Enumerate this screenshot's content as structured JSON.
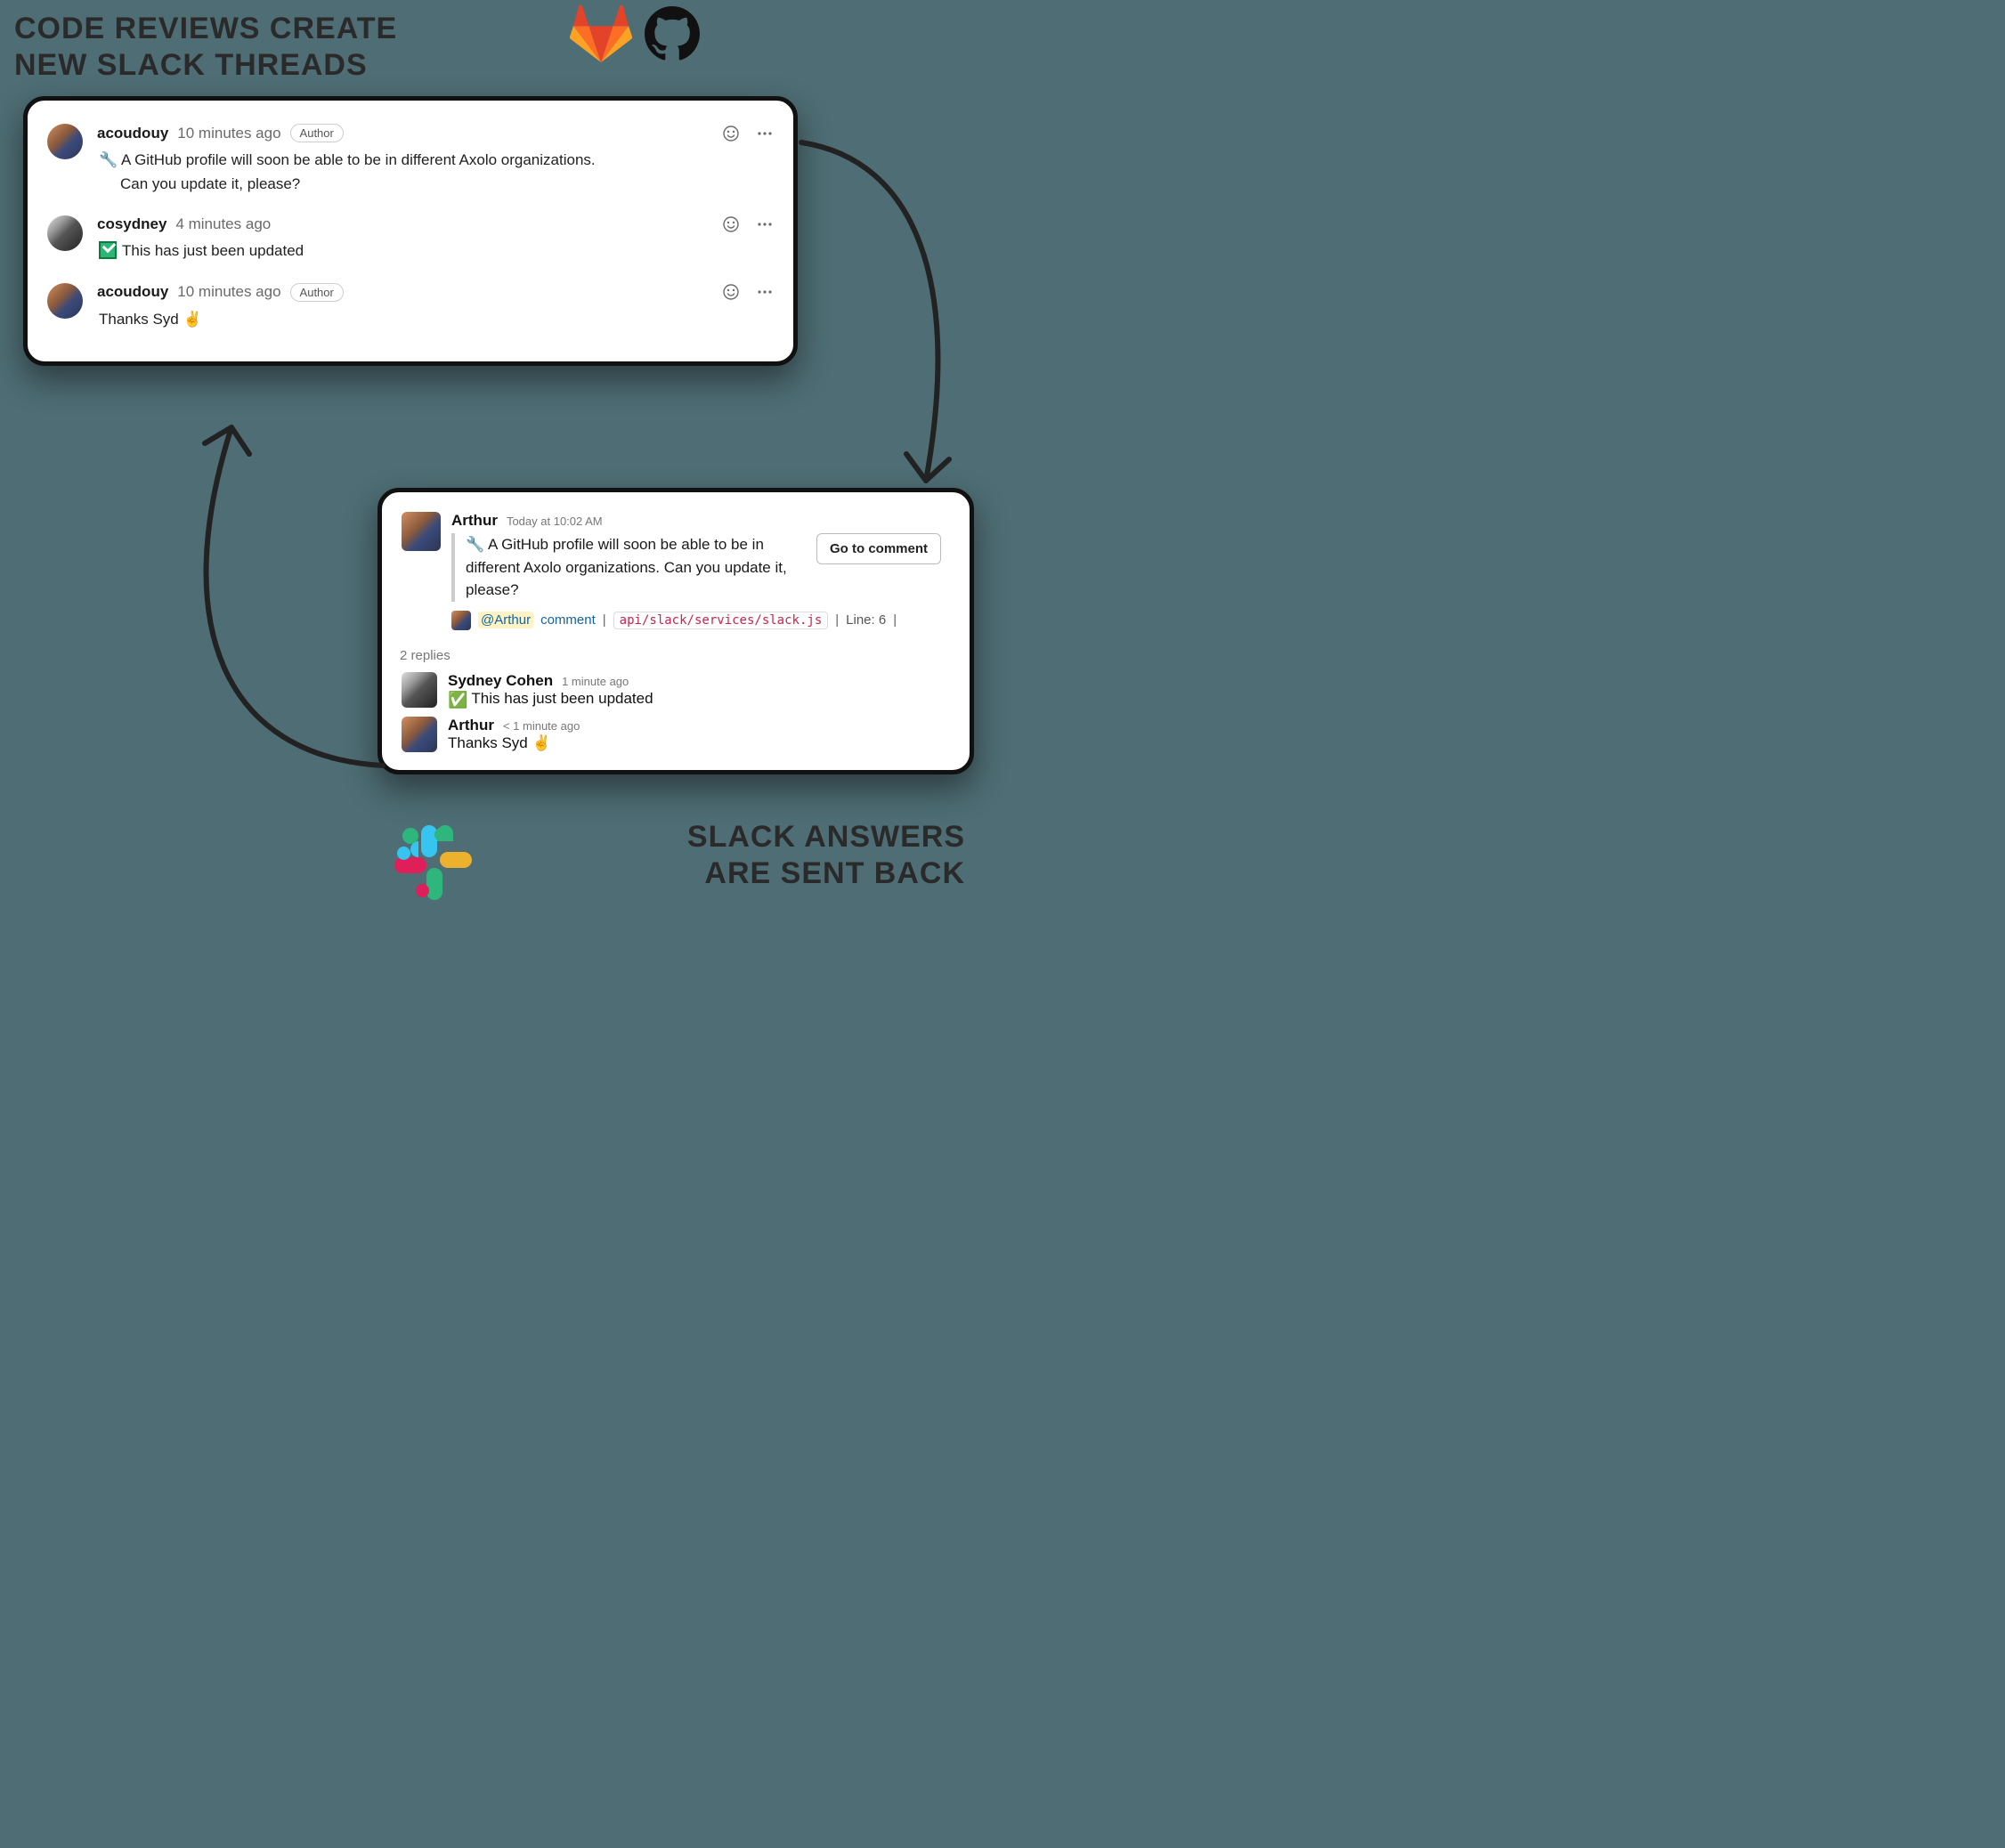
{
  "headings": {
    "top": "CODE REVIEWS CREATE\nNEW SLACK THREADS",
    "bottom": "SLACK ANSWERS\nARE SENT BACK"
  },
  "github": {
    "comments": [
      {
        "user": "acoudouy",
        "time": "10 minutes ago",
        "badge": "Author",
        "avatar": "arthur",
        "lines": [
          "🔧 A GitHub profile will soon be able to be in different Axolo organizations.",
          "Can you update it, please?"
        ]
      },
      {
        "user": "cosydney",
        "time": "4 minutes ago",
        "badge": null,
        "avatar": "sydney",
        "lines": [
          "This has just been updated"
        ],
        "check": true
      },
      {
        "user": "acoudouy",
        "time": "10 minutes ago",
        "badge": "Author",
        "avatar": "arthur",
        "lines": [
          "Thanks Syd ✌️"
        ]
      }
    ]
  },
  "slack": {
    "main": {
      "name": "Arthur",
      "time": "Today at 10:02 AM",
      "avatar": "arthur",
      "quote": "🔧 A GitHub profile will soon be able to be in different Axolo organizations. Can you update it, please?",
      "button": "Go to comment",
      "meta": {
        "mention": "@Arthur",
        "link": "comment",
        "code": "api/slack/services/slack.js",
        "line": "Line: 6"
      }
    },
    "replies_label": "2 replies",
    "replies": [
      {
        "name": "Sydney Cohen",
        "time": "1 minute ago",
        "avatar": "sydney",
        "text": "This has just been updated",
        "check": true
      },
      {
        "name": "Arthur",
        "time": "< 1 minute ago",
        "avatar": "arthur",
        "text": "Thanks Syd ✌️"
      }
    ]
  }
}
